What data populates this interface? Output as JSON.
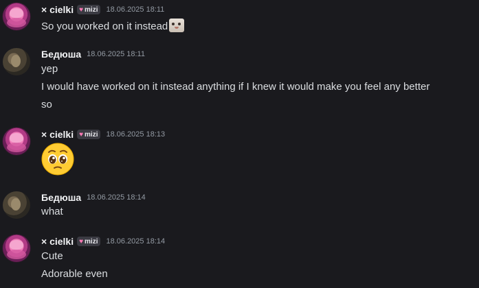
{
  "messages": [
    {
      "author": "× cielki",
      "badge": "mizi",
      "timestamp": "18.06.2025 18:11",
      "lines": [
        "So you worked on it instead"
      ],
      "inline_emote_icon": "cat-emote-icon"
    },
    {
      "author": "Бедюша",
      "timestamp": "18.06.2025 18:11",
      "lines": [
        "yep",
        "I would have worked on it instead anything if I knew it would make you feel any better",
        "so"
      ]
    },
    {
      "author": "× cielki",
      "badge": "mizi",
      "timestamp": "18.06.2025 18:13",
      "emoji_icon": "pleading-face-emoji"
    },
    {
      "author": "Бедюша",
      "timestamp": "18.06.2025 18:14",
      "lines": [
        "what"
      ]
    },
    {
      "author": "× cielki",
      "badge": "mizi",
      "timestamp": "18.06.2025 18:14",
      "lines": [
        "Cute",
        "Adorable even"
      ]
    }
  ],
  "colors": {
    "background": "#1a1a1e",
    "text": "#dbdee1",
    "username": "#f2f3f5",
    "timestamp": "#949ba4",
    "badge_bg": "#3a3a42",
    "badge_heart": "#ff7ab6"
  }
}
